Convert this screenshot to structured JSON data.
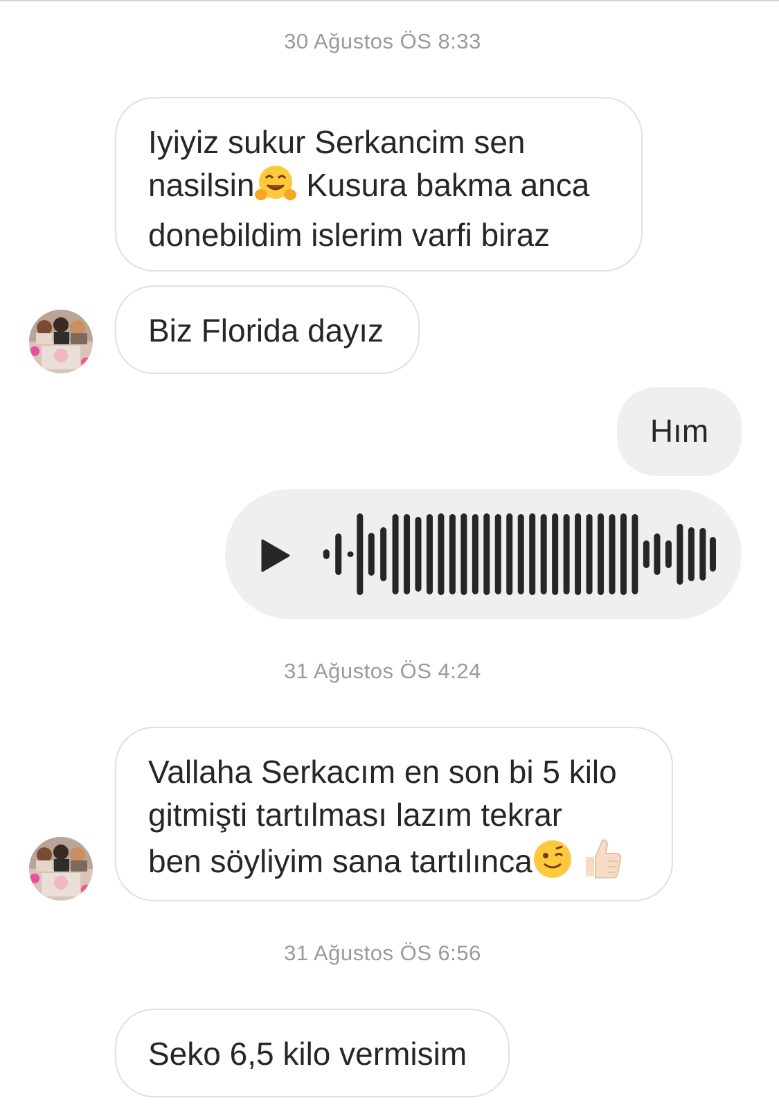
{
  "conversation": {
    "timestamps": [
      "30 Ağustos ÖS 8:33",
      "31 Ağustos ÖS 4:24",
      "31 Ağustos ÖS 6:56"
    ],
    "messages": [
      {
        "direction": "incoming",
        "lines": [
          "Iyiyiz sukur Serkancim sen",
          "nasilsin",
          "Kusura bakma anca",
          "donebildim islerim varfi biraz"
        ],
        "emoji": [
          "hugging-face"
        ]
      },
      {
        "direction": "incoming",
        "text": "Biz Florida dayız"
      },
      {
        "direction": "outgoing",
        "text": "Hım"
      },
      {
        "direction": "outgoing",
        "type": "voice-message",
        "icon": "play-icon"
      },
      {
        "direction": "incoming",
        "lines": [
          "Vallaha Serkacım en son bi 5 kilo",
          "gitmişti tartılması lazım tekrar",
          "ben söyliyim sana tartılınca"
        ],
        "emoji": [
          "winking-face",
          "thumbs-up"
        ]
      },
      {
        "direction": "incoming",
        "text": "Seko 6,5 kilo vermisim"
      }
    ]
  },
  "colors": {
    "incoming_bubble_border": "#e0e0e0",
    "outgoing_bubble_bg": "#efefef",
    "timestamp_text": "#9a9a9a",
    "message_text": "#262626"
  }
}
